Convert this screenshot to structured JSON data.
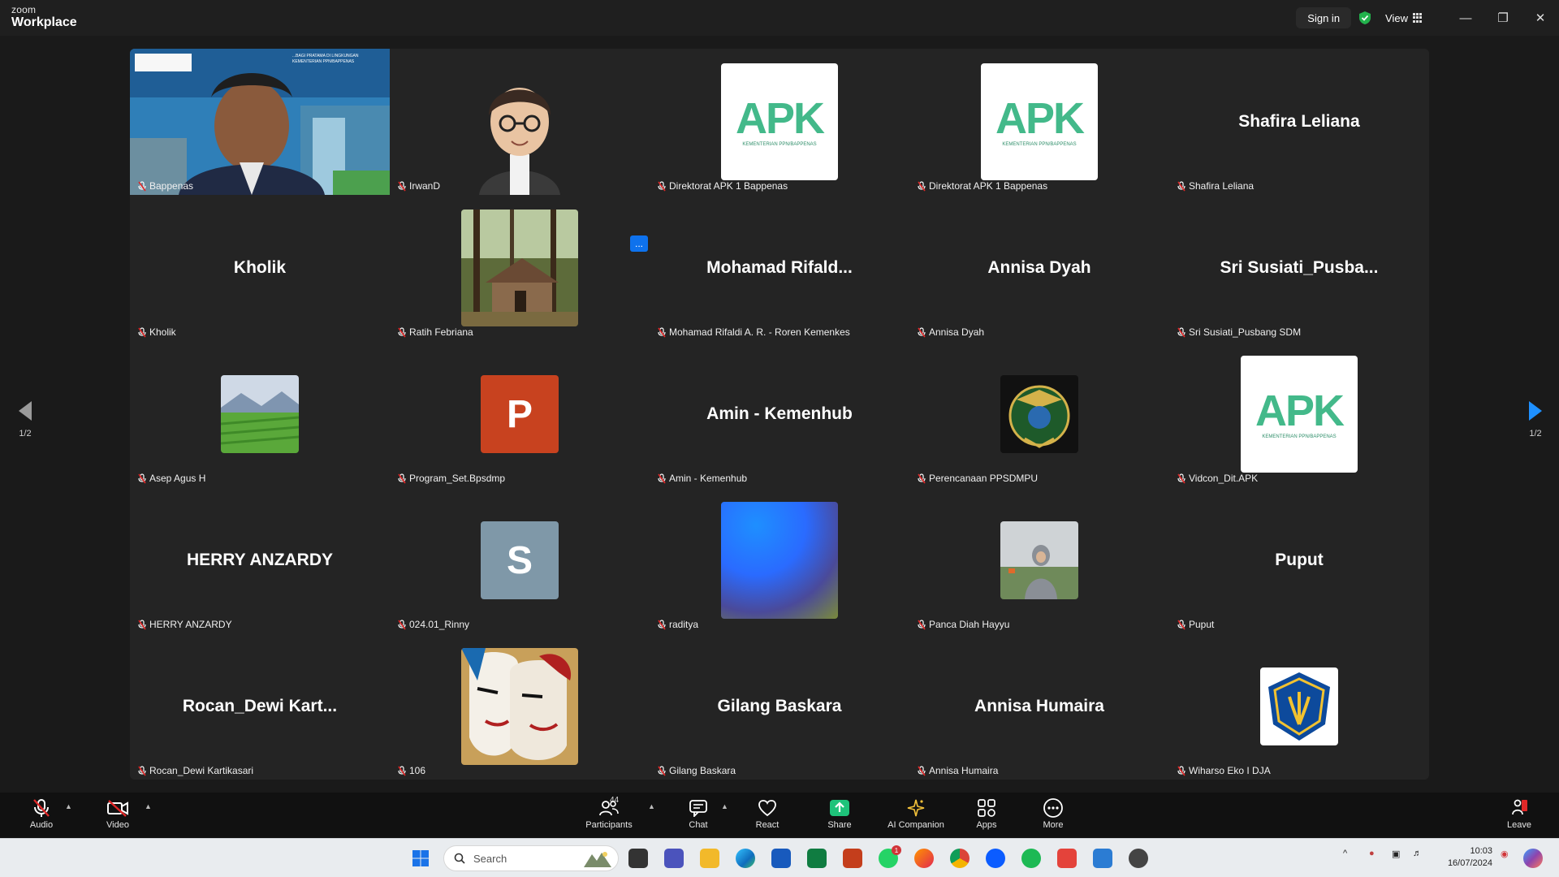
{
  "titlebar": {
    "brand_top": "zoom",
    "brand_bottom": "Workplace",
    "sign_in": "Sign in",
    "view": "View",
    "minimize_icon": "minimize-icon",
    "restore_icon": "restore-icon",
    "close_icon": "close-icon"
  },
  "gallery": {
    "page_indicator": "1/2",
    "tiles": [
      {
        "name": "Bappenas",
        "display": "video",
        "slide_lines": [
          "...BAGI PRATAMA DI LINGKUNGAN",
          "KEMENTERIAN PPN/BAPPENAS"
        ]
      },
      {
        "name": "IrwanD",
        "display": "avatar"
      },
      {
        "name": "Direktorat APK 1 Bappenas",
        "display": "apk-logo"
      },
      {
        "name": "Direktorat APK 1 Bappenas",
        "display": "apk-logo"
      },
      {
        "name": "Shafira Leliana",
        "display": "text",
        "center": "Shafira Leliana"
      },
      {
        "name": "Kholik",
        "display": "text",
        "center": "Kholik"
      },
      {
        "name": "Ratih Febriana",
        "display": "photo-house"
      },
      {
        "name": "Mohamad Rifaldi A. R. - Roren Kemenkes",
        "display": "text",
        "center": "Mohamad  Rifald..."
      },
      {
        "name": "Annisa Dyah",
        "display": "text",
        "center": "Annisa Dyah"
      },
      {
        "name": "Sri Susiati_Pusbang SDM",
        "display": "text",
        "center": "Sri  Susiati_Pusba..."
      },
      {
        "name": "Asep Agus H",
        "display": "photo-field"
      },
      {
        "name": "Program_Set.Bpsdmp",
        "display": "letter",
        "letter": "P"
      },
      {
        "name": "Amin - Kemenhub",
        "display": "text",
        "center": "Amin - Kemenhub"
      },
      {
        "name": "Perencanaan PPSDMPU",
        "display": "emblem"
      },
      {
        "name": "Vidcon_Dit.APK",
        "display": "apk-logo"
      },
      {
        "name": "HERRY ANZARDY",
        "display": "text",
        "center": "HERRY ANZARDY"
      },
      {
        "name": "024.01_Rinny",
        "display": "letter",
        "letter": "S"
      },
      {
        "name": "raditya",
        "display": "gradient"
      },
      {
        "name": "Panca Diah Hayyu",
        "display": "photo-person"
      },
      {
        "name": "Puput",
        "display": "text",
        "center": "Puput"
      },
      {
        "name": "Rocan_Dewi Kartikasari",
        "display": "text",
        "center": "Rocan_Dewi  Kart..."
      },
      {
        "name": "106",
        "display": "photo-masks"
      },
      {
        "name": "Gilang Baskara",
        "display": "text",
        "center": "Gilang Baskara"
      },
      {
        "name": "Annisa Humaira",
        "display": "text",
        "center": "Annisa Humaira"
      },
      {
        "name": "Wiharso Eko I DJA",
        "display": "kemenkeu-logo"
      }
    ],
    "more_badge": "..."
  },
  "apk_logo": {
    "text": "APK",
    "subtext": "KEMENTERIAN PPN/BAPPENAS"
  },
  "toolbar": {
    "audio": "Audio",
    "video": "Video",
    "participants": "Participants",
    "participants_count": "44",
    "chat": "Chat",
    "react": "React",
    "share": "Share",
    "ai_companion": "AI Companion",
    "apps": "Apps",
    "more": "More",
    "leave": "Leave"
  },
  "taskbar": {
    "search_placeholder": "Search",
    "time": "10:03",
    "date": "16/07/2024",
    "whatsapp_badge": "1"
  },
  "colors": {
    "accent": "#0e72ed",
    "share_green": "#1ec37a",
    "leave_red": "#e02828",
    "apk_green": "#43b98a"
  }
}
